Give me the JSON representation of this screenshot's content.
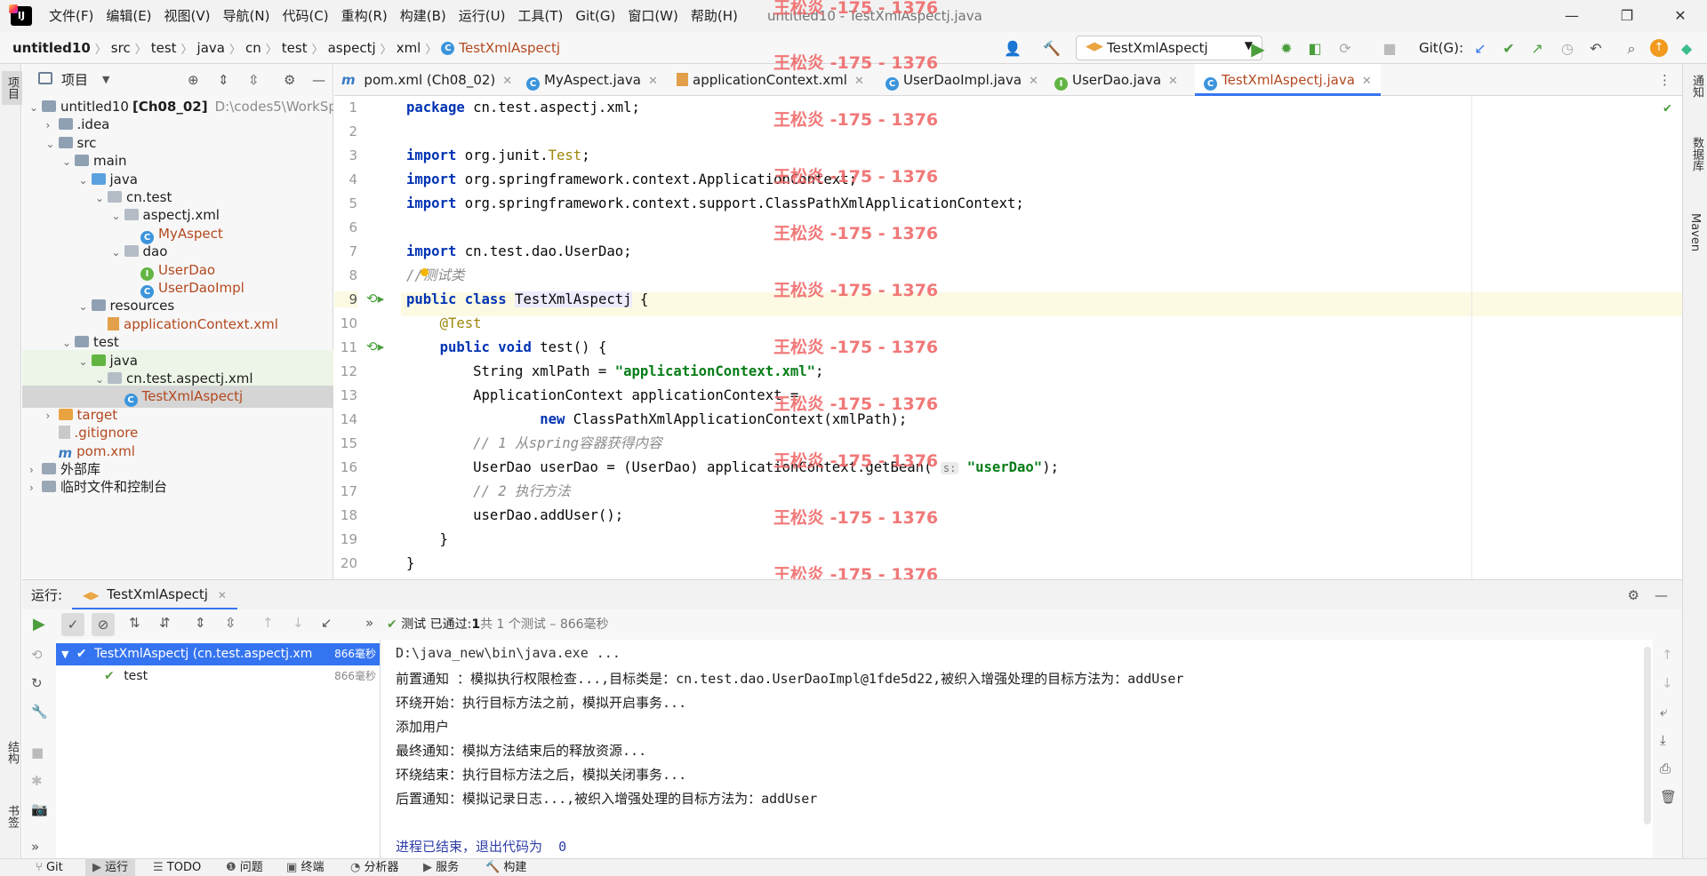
{
  "menubar": {
    "items": [
      "文件(F)",
      "编辑(E)",
      "视图(V)",
      "导航(N)",
      "代码(C)",
      "重构(R)",
      "构建(B)",
      "运行(U)",
      "工具(T)",
      "Git(G)",
      "窗口(W)",
      "帮助(H)"
    ],
    "window_title": "untitled10 - TestXmlAspectj.java"
  },
  "breadcrumb": [
    "untitled10",
    "src",
    "test",
    "java",
    "cn",
    "test",
    "aspectj",
    "xml",
    "TestXmlAspectj"
  ],
  "toolbar": {
    "run_config": "TestXmlAspectj",
    "git_label": "Git(G):"
  },
  "project": {
    "title": "项目",
    "tree": [
      {
        "label": "untitled10",
        "bold_suffix": "[Ch08_02]",
        "extra": "D:\\codes5\\WorkSp",
        "depth": 0,
        "arrow": "open",
        "icon": "folder"
      },
      {
        "label": ".idea",
        "depth": 1,
        "arrow": "closed",
        "icon": "folder"
      },
      {
        "label": "src",
        "depth": 1,
        "arrow": "open",
        "icon": "folder"
      },
      {
        "label": "main",
        "depth": 2,
        "arrow": "open",
        "icon": "folder"
      },
      {
        "label": "java",
        "depth": 3,
        "arrow": "open",
        "icon": "folder-blue"
      },
      {
        "label": "cn.test",
        "depth": 4,
        "arrow": "open",
        "icon": "package"
      },
      {
        "label": "aspectj.xml",
        "depth": 5,
        "arrow": "open",
        "icon": "package"
      },
      {
        "label": "MyAspect",
        "depth": 6,
        "arrow": "none",
        "icon": "class",
        "color": "orange"
      },
      {
        "label": "dao",
        "depth": 5,
        "arrow": "open",
        "icon": "package"
      },
      {
        "label": "UserDao",
        "depth": 6,
        "arrow": "none",
        "icon": "interface",
        "color": "orange"
      },
      {
        "label": "UserDaoImpl",
        "depth": 6,
        "arrow": "none",
        "icon": "class",
        "color": "orange"
      },
      {
        "label": "resources",
        "depth": 3,
        "arrow": "open",
        "icon": "folder"
      },
      {
        "label": "applicationContext.xml",
        "depth": 4,
        "arrow": "none",
        "icon": "xml",
        "color": "orange"
      },
      {
        "label": "test",
        "depth": 2,
        "arrow": "open",
        "icon": "folder"
      },
      {
        "label": "java",
        "depth": 3,
        "arrow": "open",
        "icon": "folder-green"
      },
      {
        "label": "cn.test.aspectj.xml",
        "depth": 4,
        "arrow": "open",
        "icon": "package"
      },
      {
        "label": "TestXmlAspectj",
        "depth": 5,
        "arrow": "none",
        "icon": "class",
        "color": "orange",
        "selected": true
      },
      {
        "label": "target",
        "depth": 1,
        "arrow": "closed",
        "icon": "folder-orange",
        "color": "orange"
      },
      {
        "label": ".gitignore",
        "depth": 1,
        "arrow": "none",
        "icon": "file",
        "color": "orange"
      },
      {
        "label": "pom.xml",
        "depth": 1,
        "arrow": "none",
        "icon": "maven",
        "color": "orange"
      },
      {
        "label": "外部库",
        "depth": 0,
        "arrow": "closed",
        "icon": "library"
      },
      {
        "label": "临时文件和控制台",
        "depth": 0,
        "arrow": "closed",
        "icon": "scratch"
      }
    ]
  },
  "editor_tabs": [
    {
      "label": "pom.xml (Ch08_02)",
      "icon": "m"
    },
    {
      "label": "MyAspect.java",
      "icon": "C"
    },
    {
      "label": "applicationContext.xml",
      "icon": "xml"
    },
    {
      "label": "UserDaoImpl.java",
      "icon": "C"
    },
    {
      "label": "UserDao.java",
      "icon": "I"
    },
    {
      "label": "TestXmlAspectj.java",
      "icon": "C",
      "active": true
    }
  ],
  "code": {
    "line_numbers": [
      "1",
      "2",
      "3",
      "4",
      "5",
      "6",
      "7",
      "8",
      "9",
      "10",
      "11",
      "12",
      "13",
      "14",
      "15",
      "16",
      "17",
      "18",
      "19",
      "20"
    ]
  },
  "watermark": "王松炎 -175 - 1376",
  "run_panel": {
    "label": "运行:",
    "tab": "TestXmlAspectj",
    "status_prefix": "测试 已通过:",
    "status_count": "1",
    "status_suffix": "共 1 个测试 – 866毫秒",
    "tree": [
      {
        "label": "TestXmlAspectj (cn.test.aspectj.xm",
        "time": "866毫秒",
        "selected": true
      },
      {
        "label": "test",
        "time": "866毫秒"
      }
    ],
    "console": [
      "D:\\java_new\\bin\\java.exe ...",
      "前置通知 ：模拟执行权限检查...,目标类是：cn.test.dao.UserDaoImpl@1fde5d22,被织入增强处理的目标方法为：addUser",
      "环绕开始：执行目标方法之前，模拟开启事务...",
      "添加用户",
      "最终通知：模拟方法结束后的释放资源...",
      "环绕结束：执行目标方法之后，模拟关闭事务...",
      "后置通知：模拟记录日志...,被织入增强处理的目标方法为：addUser",
      "",
      "进程已结束，退出代码为  0"
    ]
  },
  "status_bar": [
    "Git",
    "运行",
    "TODO",
    "问题",
    "终端",
    "分析器",
    "服务",
    "构建"
  ],
  "side_labels": {
    "left": [
      "项目",
      "结构",
      "书签"
    ],
    "right": [
      "通知",
      "数据库",
      "Maven"
    ]
  }
}
